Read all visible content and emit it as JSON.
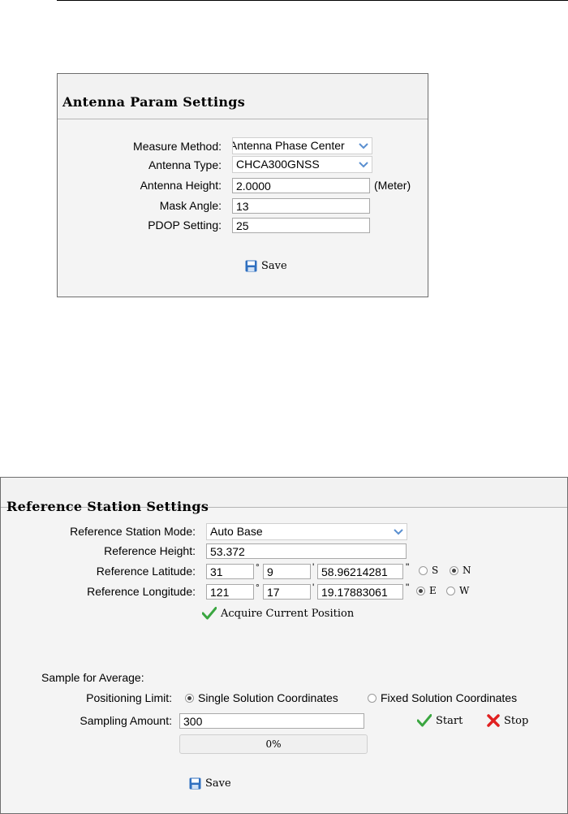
{
  "antenna": {
    "title": "Antenna Param Settings",
    "measure_method": {
      "label": "Measure Method:",
      "value": "Antenna Phase Center"
    },
    "antenna_type": {
      "label": "Antenna Type:",
      "value": "CHCA300GNSS"
    },
    "antenna_height": {
      "label": "Antenna Height:",
      "value": "2.0000",
      "unit": "(Meter)"
    },
    "mask_angle": {
      "label": "Mask Angle:",
      "value": "13"
    },
    "pdop": {
      "label": "PDOP Setting:",
      "value": "25"
    },
    "save_label": "Save"
  },
  "reference": {
    "title": "Reference Station Settings",
    "mode": {
      "label": "Reference Station Mode:",
      "value": "Auto Base"
    },
    "height": {
      "label": "Reference Height:",
      "value": "53.372"
    },
    "latitude": {
      "label": "Reference Latitude:",
      "deg": "31",
      "min": "9",
      "sec": "58.96214281",
      "options": [
        "S",
        "N"
      ],
      "selected": "N"
    },
    "longitude": {
      "label": "Reference Longitude:",
      "deg": "121",
      "min": "17",
      "sec": "19.17883061",
      "options": [
        "E",
        "W"
      ],
      "selected": "E"
    },
    "deg_symbol": "°",
    "min_symbol": "'",
    "sec_symbol": "\"",
    "acquire_label": "Acquire Current Position",
    "sample_heading": "Sample for Average:",
    "positioning_limit": {
      "label": "Positioning Limit:",
      "options": [
        "Single Solution Coordinates",
        "Fixed Solution Coordinates"
      ],
      "selected": "Single Solution Coordinates"
    },
    "sampling_amount": {
      "label": "Sampling Amount:",
      "value": "300"
    },
    "start_label": "Start",
    "stop_label": "Stop",
    "progress": {
      "value": 0,
      "text": "0%"
    },
    "save_label": "Save"
  },
  "colors": {
    "check_green": "#3aa640",
    "stop_red": "#e02020",
    "save_blue": "#2f6fbf",
    "progress_fill": "#7fb3e8"
  },
  "icons": [
    "save-icon",
    "chevron-down-icon",
    "checkmark-icon",
    "cross-icon"
  ]
}
